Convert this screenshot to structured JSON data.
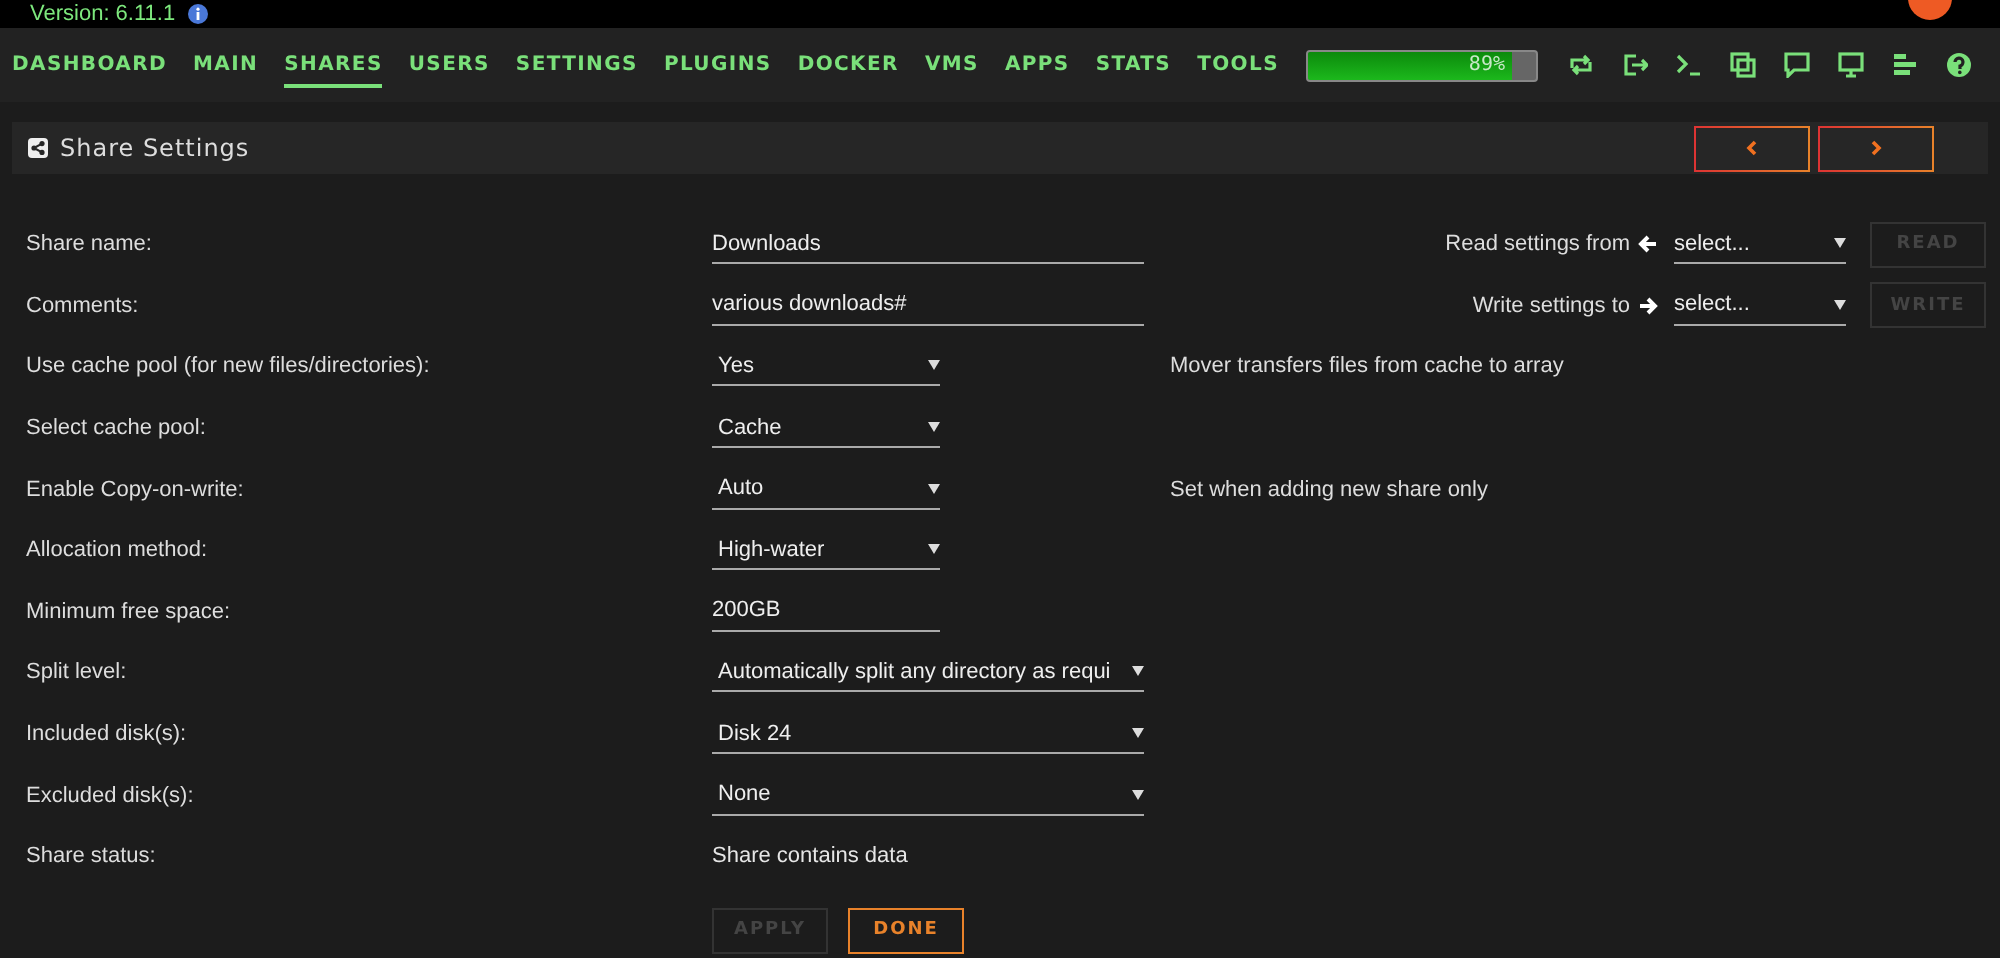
{
  "version": "Version: 6.11.1",
  "nav": [
    {
      "label": "DASHBOARD",
      "selected": false
    },
    {
      "label": "MAIN",
      "selected": false
    },
    {
      "label": "SHARES",
      "selected": true
    },
    {
      "label": "USERS",
      "selected": false
    },
    {
      "label": "SETTINGS",
      "selected": false
    },
    {
      "label": "PLUGINS",
      "selected": false
    },
    {
      "label": "DOCKER",
      "selected": false
    },
    {
      "label": "VMS",
      "selected": false
    },
    {
      "label": "APPS",
      "selected": false
    },
    {
      "label": "STATS",
      "selected": false
    },
    {
      "label": "TOOLS",
      "selected": false
    }
  ],
  "usage": {
    "level": 0.89,
    "reading": "89%"
  },
  "panel": {
    "title": "Share Settings"
  },
  "copy": [
    {
      "label": "Read settings from",
      "kind": "read",
      "value": "select...",
      "button": "READ",
      "disabled": true
    },
    {
      "label": "Write settings to",
      "kind": "write",
      "value": "select...",
      "button": "WRITE",
      "disabled": true
    }
  ],
  "rows": [
    {
      "label": "Share name:",
      "kind": "text",
      "value": "Downloads"
    },
    {
      "label": "Comments:",
      "kind": "text",
      "value": "various downloads#"
    },
    {
      "label": "Use cache pool (for new files/directories):",
      "kind": "select",
      "value": "Yes",
      "note": "Mover transfers files from cache to array"
    },
    {
      "label": "Select cache pool:",
      "kind": "select",
      "value": "Cache"
    },
    {
      "label": "Enable Copy-on-write:",
      "kind": "select",
      "value": "Auto",
      "note": "Set when adding new share only"
    },
    {
      "label": "Allocation method:",
      "kind": "select",
      "value": "High-water"
    },
    {
      "label": "Minimum free space:",
      "kind": "text",
      "value": "200GB"
    },
    {
      "label": "Split level:",
      "kind": "select",
      "value": "Automatically split any directory as requi"
    },
    {
      "label": "Included disk(s):",
      "kind": "select",
      "value": "Disk 24"
    },
    {
      "label": "Excluded disk(s):",
      "kind": "select",
      "value": "None"
    },
    {
      "label": "Share status:",
      "kind": "static",
      "value": "Share contains data"
    }
  ],
  "buttons": [
    {
      "label": "APPLY",
      "disabled": true
    },
    {
      "label": "DONE",
      "disabled": false
    }
  ]
}
